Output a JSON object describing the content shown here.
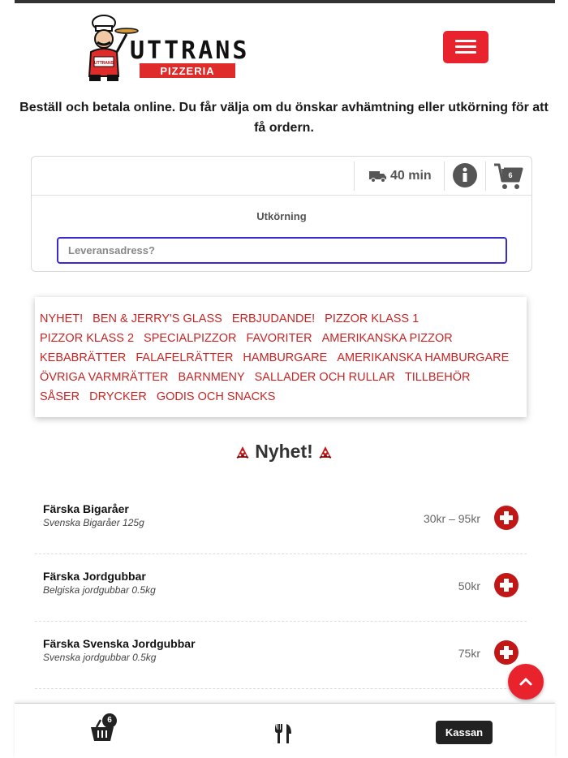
{
  "header": {
    "logo_text_main": "UTTRANS",
    "logo_text_sub": "PIZZERIA",
    "logo_badge": "UTTRANS"
  },
  "intro_text": "Beställ och betala online. Du får välja om du önskar avhämtning eller utkörning för att få ordern.",
  "delivery": {
    "eta": "40 min",
    "cart_count": "6",
    "mode_label": "Utkörning",
    "address_placeholder": "Leveransadress?",
    "address_value": ""
  },
  "categories": [
    "NYHET!",
    "BEN & JERRY'S GLASS",
    "ERBJUDANDE!",
    "PIZZOR KLASS 1",
    "PIZZOR KLASS 2",
    "SPECIALPIZZOR",
    "FAVORITER",
    "AMERIKANSKA PIZZOR",
    "KEBABRÄTTER",
    "FALAFELRÄTTER",
    "HAMBURGARE",
    "AMERIKANSKA HAMBURGARE",
    "ÖVRIGA VARMRÄTTER",
    "BARNMENY",
    "SALLADER OCH RULLAR",
    "TILLBEHÖR",
    "SÅSER",
    "DRYCKER",
    "GODIS OCH SNACKS"
  ],
  "section": {
    "title": "Nyhet!"
  },
  "items": [
    {
      "name": "Färska Bigaråer",
      "desc": "Svenska Bigaråer 125g",
      "price": "30kr – 95kr"
    },
    {
      "name": "Färska Jordgubbar",
      "desc": "Belgiska jordgubbar 0.5kg",
      "price": "50kr"
    },
    {
      "name": "Färska Svenska Jordgubbar",
      "desc": "Svenska jordgubbar 0.5kg",
      "price": "75kr"
    }
  ],
  "bottombar": {
    "basket_count": "6",
    "checkout_label": "Kassan"
  },
  "colors": {
    "accent": "#e8232d",
    "link": "#c72525",
    "dark": "#222222",
    "input_border": "#3a2bd1"
  }
}
